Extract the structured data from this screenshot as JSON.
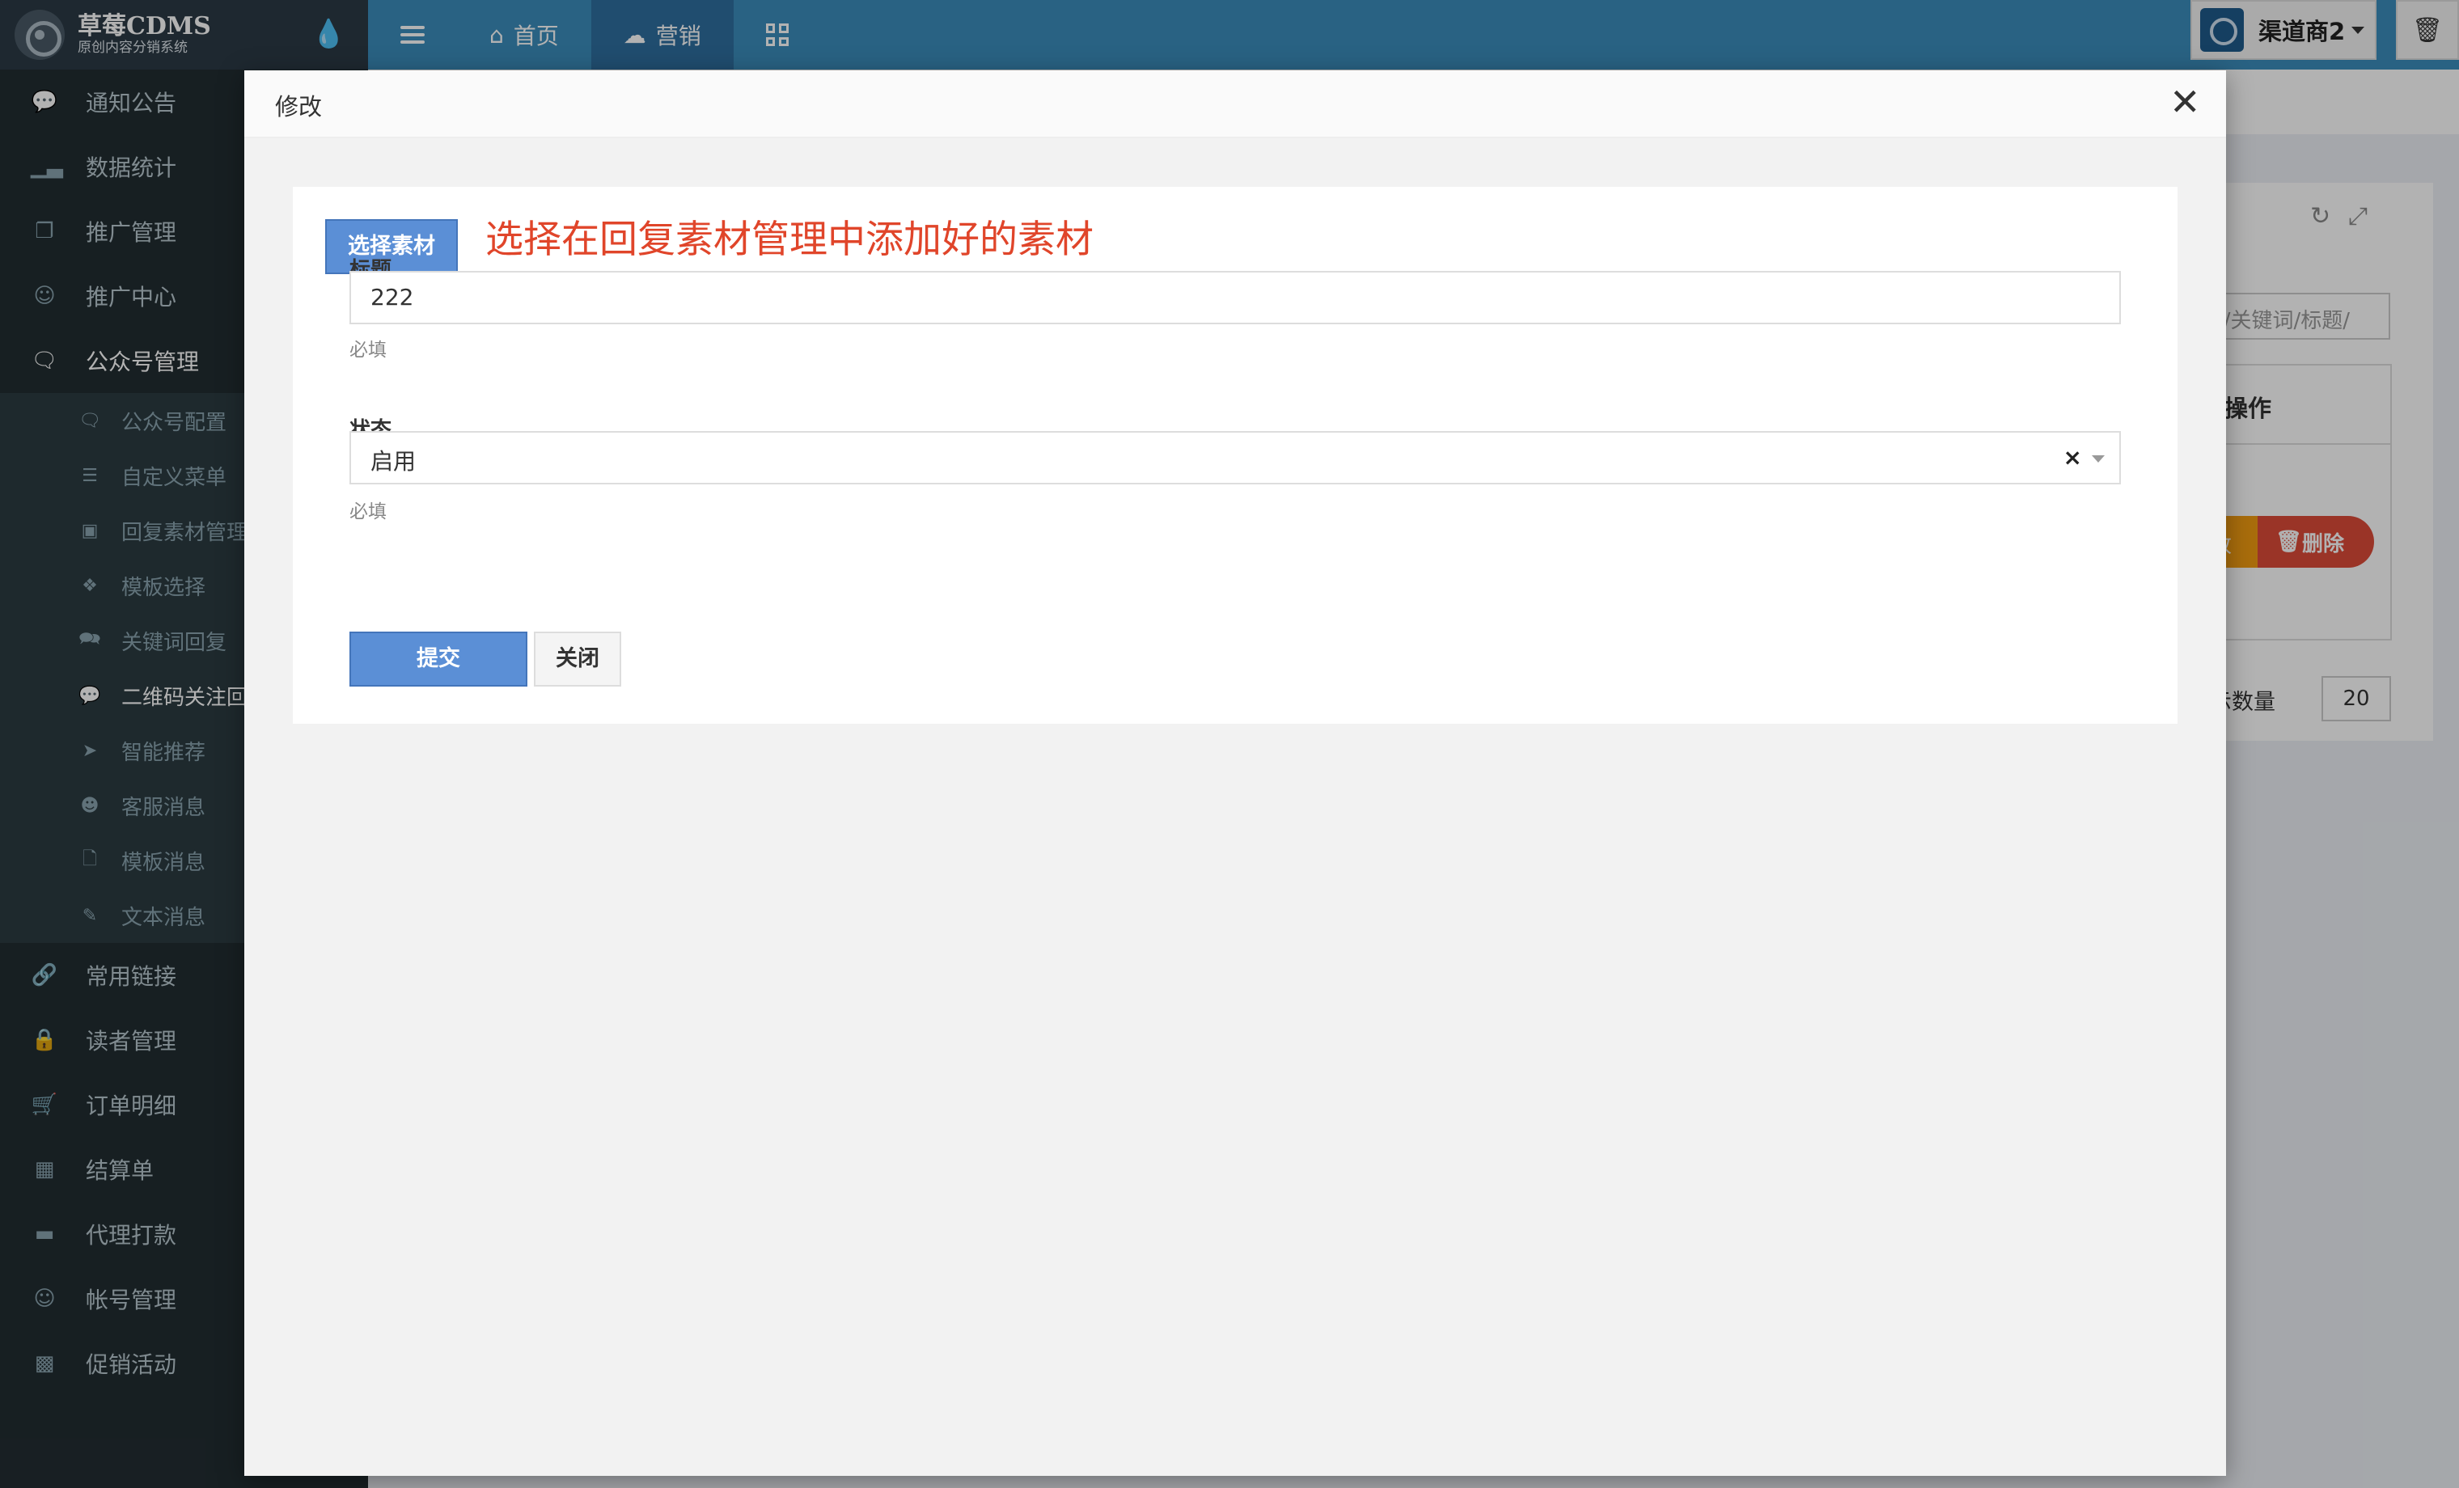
{
  "app": {
    "logo_title": "草莓CDMS",
    "logo_subtitle": "原创内容分销系统"
  },
  "topnav": {
    "items": [
      {
        "label": "首页",
        "icon": "home-icon"
      },
      {
        "label": "营销",
        "icon": "cloud-icon",
        "active": true
      }
    ]
  },
  "user": {
    "name": "渠道商2"
  },
  "sidebar": {
    "items": [
      {
        "label": "通知公告",
        "icon": "comment-icon"
      },
      {
        "label": "数据统计",
        "icon": "bar-chart-icon"
      },
      {
        "label": "推广管理",
        "icon": "copy-icon"
      },
      {
        "label": "推广中心",
        "icon": "user-secret-icon"
      },
      {
        "label": "公众号管理",
        "icon": "wechat-icon"
      }
    ],
    "submenu": [
      {
        "label": "公众号配置",
        "icon": "wechat-icon"
      },
      {
        "label": "自定义菜单",
        "icon": "list-icon"
      },
      {
        "label": "回复素材管理",
        "icon": "image-icon"
      },
      {
        "label": "模板选择",
        "icon": "puzzle-icon"
      },
      {
        "label": "关键词回复",
        "icon": "comments-icon"
      },
      {
        "label": "二维码关注回",
        "icon": "comment-dots-icon"
      },
      {
        "label": "智能推荐",
        "icon": "paper-plane-icon"
      },
      {
        "label": "客服消息",
        "icon": "user-icon"
      },
      {
        "label": "模板消息",
        "icon": "file-icon"
      },
      {
        "label": "文本消息",
        "icon": "edit-icon"
      }
    ],
    "items_after": [
      {
        "label": "常用链接",
        "icon": "link-icon"
      },
      {
        "label": "读者管理",
        "icon": "lock-icon"
      },
      {
        "label": "订单明细",
        "icon": "cart-icon"
      },
      {
        "label": "结算单",
        "icon": "calculator-icon"
      },
      {
        "label": "代理打款",
        "icon": "credit-card-icon"
      },
      {
        "label": "帐号管理",
        "icon": "user-plus-icon"
      },
      {
        "label": "促销活动",
        "icon": "briefcase-icon"
      }
    ]
  },
  "background": {
    "search_placeholder": "ID/关键词/标题/",
    "table_header": "操作",
    "edit_label": "改",
    "delete_label": "删除",
    "page_size_label": "显示数量",
    "page_size_value": "20"
  },
  "modal": {
    "title": "修改",
    "pick_button": "选择素材",
    "pick_hint": "选择在回复素材管理中添加好的素材",
    "fields": {
      "title_label": "标题",
      "title_value": "222",
      "title_help": "必填",
      "status_label": "状态",
      "status_value": "启用",
      "status_help": "必填"
    },
    "submit_label": "提交",
    "close_label": "关闭"
  }
}
